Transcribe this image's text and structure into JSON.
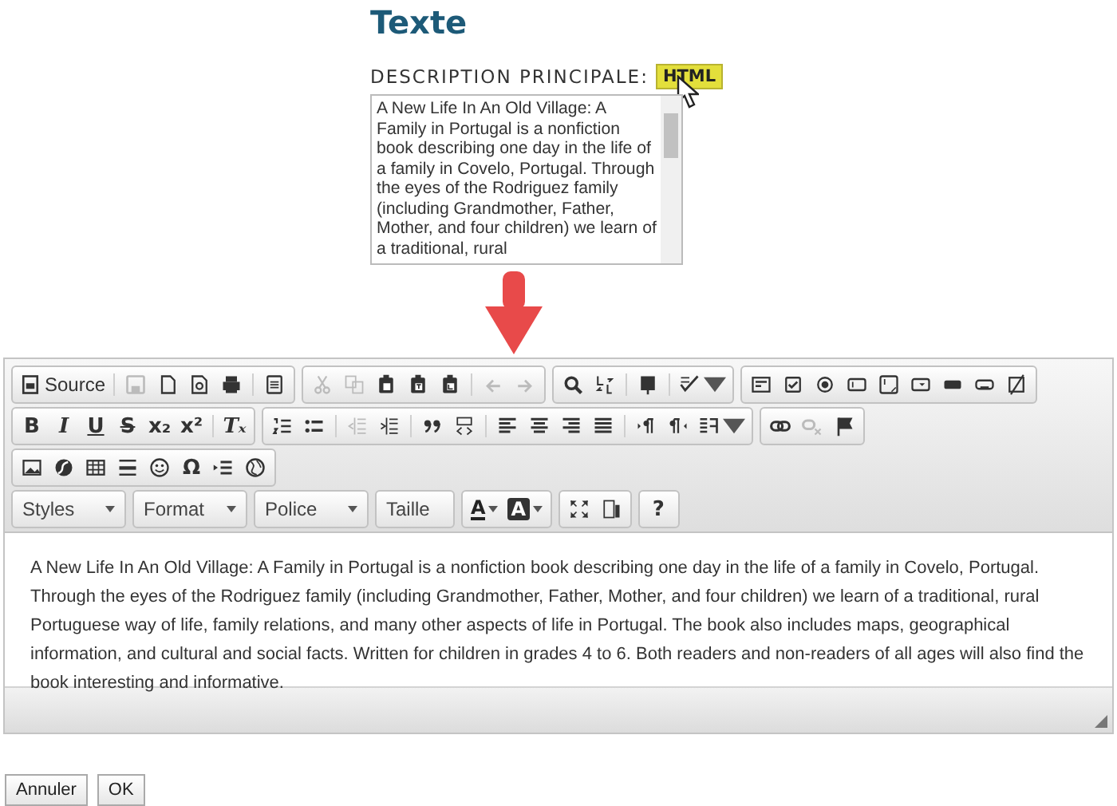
{
  "heading": "Texte",
  "field": {
    "label": "DESCRIPTION PRINCIPALE:",
    "badge": "HTML",
    "text": "A New Life In An Old Village: A Family in Portugal is a nonfiction book describing one day in the life of a family in Covelo, Portugal. Through the eyes of the Rodriguez family (including Grandmother, Father, Mother, and four children) we learn of a traditional, rural"
  },
  "toolbar": {
    "rows": [
      {
        "groups": [
          {
            "items": [
              {
                "kind": "button",
                "label": "Source",
                "disabled": false
              },
              {
                "kind": "separator"
              },
              {
                "kind": "button",
                "disabled": true
              },
              {
                "kind": "button",
                "disabled": false
              },
              {
                "kind": "button",
                "disabled": false
              },
              {
                "kind": "button",
                "disabled": false
              },
              {
                "kind": "separator"
              },
              {
                "kind": "button",
                "disabled": false
              }
            ]
          },
          {
            "items": [
              {
                "kind": "button",
                "disabled": true
              },
              {
                "kind": "button",
                "disabled": true
              },
              {
                "kind": "button",
                "disabled": false
              },
              {
                "kind": "button",
                "disabled": false
              },
              {
                "kind": "button",
                "disabled": false
              },
              {
                "kind": "separator"
              },
              {
                "kind": "button",
                "disabled": true
              },
              {
                "kind": "button",
                "disabled": true
              }
            ]
          },
          {
            "items": [
              {
                "kind": "button",
                "disabled": false
              },
              {
                "kind": "button",
                "disabled": false
              },
              {
                "kind": "separator"
              },
              {
                "kind": "button",
                "disabled": false
              },
              {
                "kind": "separator"
              },
              {
                "kind": "button",
                "disabled": false
              }
            ]
          },
          {
            "items": [
              {
                "kind": "button",
                "disabled": false
              },
              {
                "kind": "button",
                "disabled": false
              },
              {
                "kind": "button",
                "disabled": false
              },
              {
                "kind": "button",
                "disabled": false
              },
              {
                "kind": "button",
                "disabled": false
              },
              {
                "kind": "button",
                "disabled": false
              },
              {
                "kind": "button",
                "disabled": false
              },
              {
                "kind": "button",
                "disabled": false
              },
              {
                "kind": "button",
                "disabled": false
              }
            ]
          }
        ]
      },
      {
        "groups": [
          {
            "items": [
              {
                "kind": "text",
                "label": "B",
                "disabled": false
              },
              {
                "kind": "text",
                "label": "I",
                "disabled": false
              },
              {
                "kind": "text",
                "label": "U",
                "disabled": false
              },
              {
                "kind": "text",
                "label": "S",
                "disabled": false
              },
              {
                "kind": "text",
                "label": "x₂",
                "disabled": false
              },
              {
                "kind": "text",
                "label": "x²",
                "disabled": false
              },
              {
                "kind": "separator"
              },
              {
                "kind": "text",
                "label": "Tₓ",
                "disabled": false
              }
            ]
          },
          {
            "items": [
              {
                "kind": "button",
                "disabled": false
              },
              {
                "kind": "button",
                "disabled": false
              },
              {
                "kind": "separator"
              },
              {
                "kind": "button",
                "disabled": true
              },
              {
                "kind": "button",
                "disabled": false
              },
              {
                "kind": "separator"
              },
              {
                "kind": "button",
                "disabled": false
              },
              {
                "kind": "button",
                "disabled": false
              },
              {
                "kind": "separator"
              },
              {
                "kind": "button",
                "disabled": false
              },
              {
                "kind": "button",
                "disabled": false
              },
              {
                "kind": "button",
                "disabled": false
              },
              {
                "kind": "button",
                "disabled": false
              },
              {
                "kind": "separator"
              },
              {
                "kind": "button",
                "disabled": false
              },
              {
                "kind": "button",
                "disabled": false
              },
              {
                "kind": "button",
                "disabled": false
              }
            ]
          },
          {
            "items": [
              {
                "kind": "button",
                "disabled": false
              },
              {
                "kind": "button",
                "disabled": true
              },
              {
                "kind": "button",
                "disabled": false
              }
            ]
          }
        ]
      },
      {
        "groups": [
          {
            "items": [
              {
                "kind": "button",
                "disabled": false
              },
              {
                "kind": "button",
                "disabled": false
              },
              {
                "kind": "button",
                "disabled": false
              },
              {
                "kind": "button",
                "disabled": false
              },
              {
                "kind": "button",
                "disabled": false
              },
              {
                "kind": "text",
                "label": "Ω",
                "disabled": false
              },
              {
                "kind": "button",
                "disabled": false
              },
              {
                "kind": "button",
                "disabled": false
              }
            ]
          }
        ]
      },
      {
        "groups": [
          {
            "items": [
              {
                "kind": "combo",
                "label": "Styles"
              }
            ]
          },
          {
            "items": [
              {
                "kind": "combo",
                "label": "Format"
              }
            ]
          },
          {
            "items": [
              {
                "kind": "combo",
                "label": "Police"
              }
            ]
          },
          {
            "items": [
              {
                "kind": "combo",
                "label": "Taille"
              }
            ]
          },
          {
            "items": [
              {
                "kind": "color",
                "label": "A"
              },
              {
                "kind": "color",
                "label": "A"
              }
            ]
          },
          {
            "items": [
              {
                "kind": "button",
                "disabled": false
              },
              {
                "kind": "button",
                "disabled": false
              }
            ]
          },
          {
            "items": [
              {
                "kind": "text",
                "label": "?",
                "disabled": false
              }
            ]
          }
        ]
      }
    ]
  },
  "content": "A New Life In An Old Village: A Family in Portugal is a nonfiction book describing one day in the life of a family in Covelo, Portugal. Through the eyes of the Rodriguez family (including Grandmother, Father, Mother, and four children) we learn of a traditional, rural Portuguese way of life, family relations, and many other aspects of life in Portugal. The book also includes maps, geographical information, and cultural and social facts. Written for children in grades 4 to 6. Both readers and non-readers of all ages will also find the book interesting and informative.",
  "buttons": [
    "Annuler",
    "OK"
  ]
}
